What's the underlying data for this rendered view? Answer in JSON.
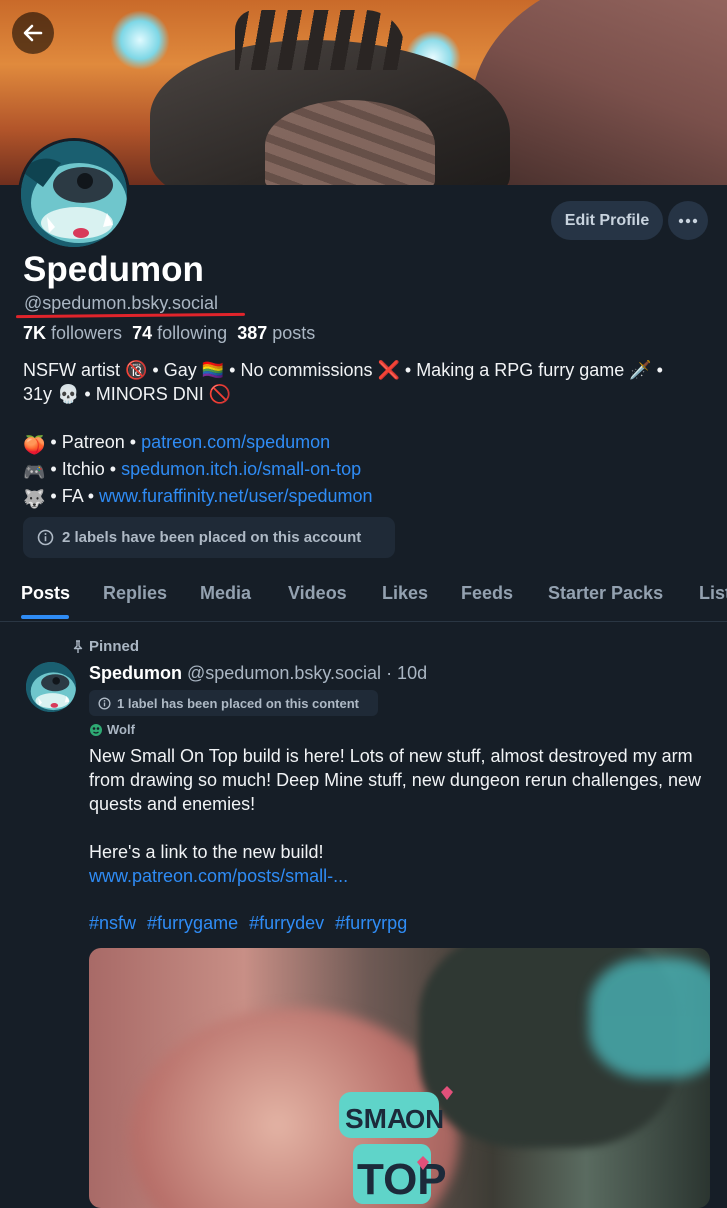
{
  "profile": {
    "display_name": "Spedumon",
    "handle": "@spedumon.bsky.social",
    "edit_profile_label": "Edit Profile"
  },
  "stats": {
    "followers_count": "7K",
    "followers_label": "followers",
    "following_count": "74",
    "following_label": "following",
    "posts_count": "387",
    "posts_label": "posts"
  },
  "bio": {
    "line1": "NSFW artist 🔞 • Gay 🏳️‍🌈 • No commissions ❌ • Making a RPG furry game 🗡️ •",
    "line2": "31y 💀 • MINORS DNI 🚫",
    "links": [
      {
        "emoji": "🍑",
        "prefix": " • Patreon • ",
        "url": "patreon.com/spedumon"
      },
      {
        "emoji": "🎮",
        "prefix": " • Itchio • ",
        "url": "spedumon.itch.io/small-on-top"
      },
      {
        "emoji": "🐺",
        "prefix": " • FA • ",
        "url": "www.furaffinity.net/user/spedumon"
      }
    ]
  },
  "account_labels_text": "2 labels have been placed on this account",
  "tabs": [
    "Posts",
    "Replies",
    "Media",
    "Videos",
    "Likes",
    "Feeds",
    "Starter Packs",
    "Lists"
  ],
  "active_tab": "Posts",
  "post": {
    "pinned_label": "Pinned",
    "author_name": "Spedumon",
    "author_handle": "@spedumon.bsky.social",
    "time": "· 10d",
    "content_label_text": "1 label has been placed on this content",
    "tag_label": "Wolf",
    "text_para1": "New Small On Top build is here! Lots of new stuff, almost destroyed my arm from drawing so much! Deep Mine stuff, new dungeon rerun challenges, new quests and enemies!",
    "text_para2": "Here's a link to the new build!",
    "link": "www.patreon.com/posts/small-...",
    "hashtags": [
      "#nsfw",
      "#furrygame",
      "#furrydev",
      "#furryrpg"
    ],
    "image_logo_text": [
      "SMA",
      "ON",
      "TOP"
    ]
  },
  "colors": {
    "background": "#161e27",
    "accent": "#2f8cf5",
    "muted": "#aab6c3",
    "pill": "#1f2a37",
    "highlight_underline": "#e0242b"
  },
  "icons": [
    "back-arrow-icon",
    "more-dots-icon",
    "info-icon",
    "pin-icon",
    "globe-icon"
  ]
}
